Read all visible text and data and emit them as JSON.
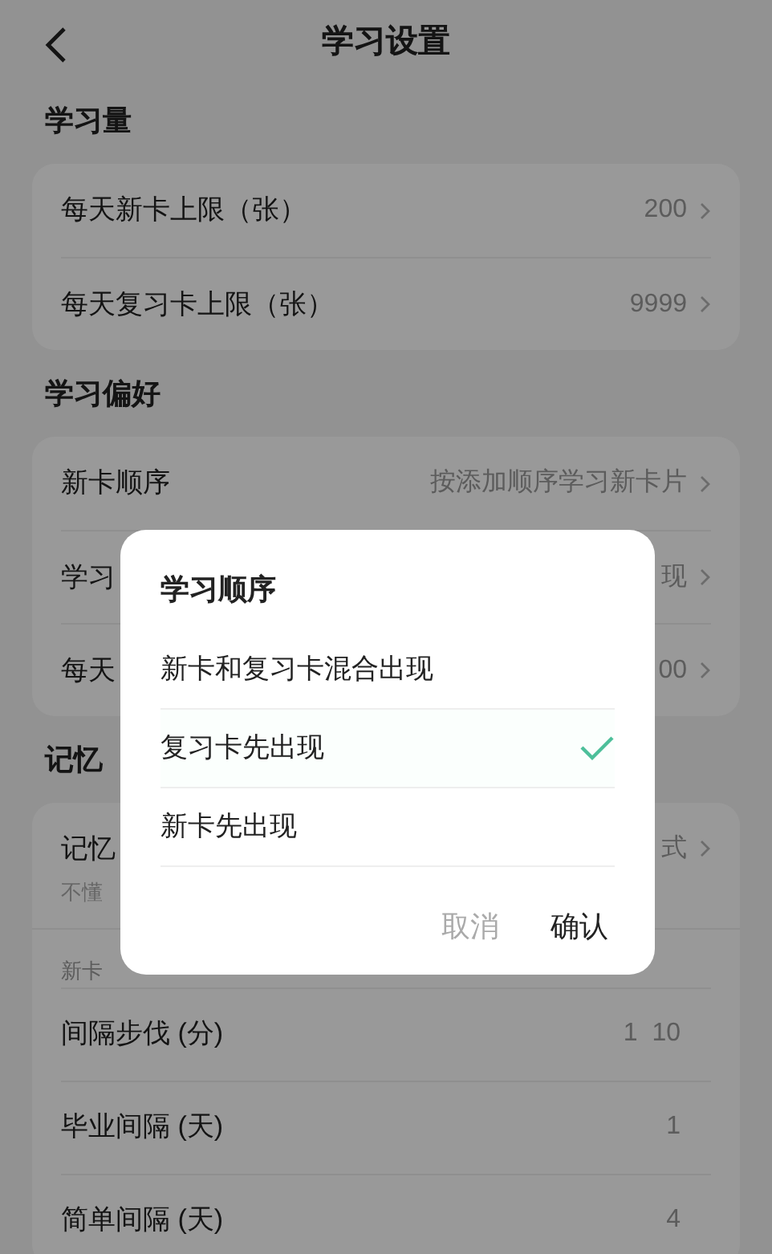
{
  "header": {
    "title": "学习设置"
  },
  "sections": [
    {
      "title": "学习量",
      "rows": [
        {
          "label": "每天新卡上限（张）",
          "value": "200",
          "chevron": true
        },
        {
          "label": "每天复习卡上限（张）",
          "value": "9999",
          "chevron": true
        }
      ]
    },
    {
      "title": "学习偏好",
      "rows": [
        {
          "label": "新卡顺序",
          "value": "按添加顺序学习新卡片",
          "chevron": true
        },
        {
          "label": "学习",
          "value": "现",
          "chevron": true
        },
        {
          "label": "每天",
          "value": "00",
          "chevron": true
        }
      ]
    },
    {
      "title": "记忆",
      "rows": [
        {
          "label": "记忆",
          "value": "式",
          "chevron": true,
          "note": "不懂"
        },
        {
          "kind": "subheader",
          "label": "新卡"
        },
        {
          "label": "间隔步伐 (分)",
          "value": "1  10",
          "chevron": false
        },
        {
          "label": "毕业间隔 (天)",
          "value": "1",
          "chevron": false
        },
        {
          "label": "简单间隔 (天)",
          "value": "4",
          "chevron": false
        }
      ]
    }
  ],
  "dialog": {
    "title": "学习顺序",
    "options": [
      {
        "label": "新卡和复习卡混合出现",
        "selected": false
      },
      {
        "label": "复习卡先出现",
        "selected": true
      },
      {
        "label": "新卡先出现",
        "selected": false
      }
    ],
    "cancel": "取消",
    "confirm": "确认"
  }
}
